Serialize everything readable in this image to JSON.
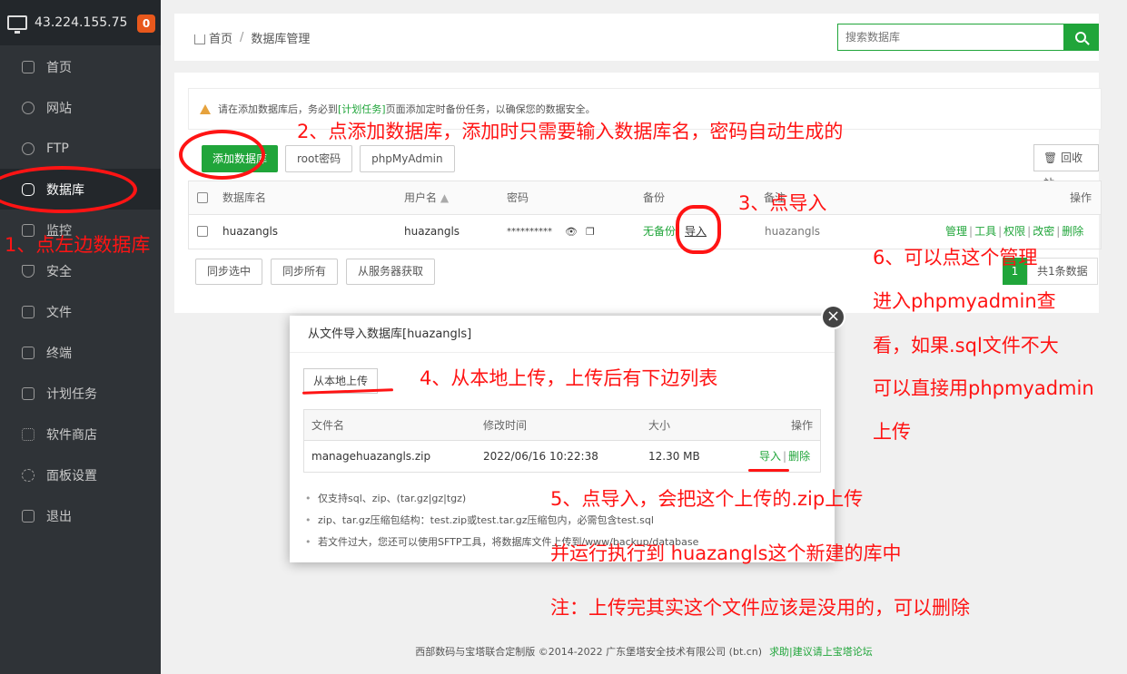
{
  "sidebar": {
    "server_ip": "43.224.155.75",
    "badge": "0",
    "items": [
      {
        "label": "首页",
        "icon": "home-icon"
      },
      {
        "label": "网站",
        "icon": "globe-icon"
      },
      {
        "label": "FTP",
        "icon": "ftp-icon"
      },
      {
        "label": "数据库",
        "icon": "database-icon"
      },
      {
        "label": "监控",
        "icon": "monitor-icon"
      },
      {
        "label": "安全",
        "icon": "shield-icon"
      },
      {
        "label": "文件",
        "icon": "folder-icon"
      },
      {
        "label": "终端",
        "icon": "terminal-icon"
      },
      {
        "label": "计划任务",
        "icon": "calendar-icon"
      },
      {
        "label": "软件商店",
        "icon": "apps-icon"
      },
      {
        "label": "面板设置",
        "icon": "gear-icon"
      },
      {
        "label": "退出",
        "icon": "logout-icon"
      }
    ]
  },
  "header": {
    "crumb_home": "首页",
    "crumb_sep": "/",
    "crumb_current": "数据库管理",
    "search_placeholder": "搜索数据库"
  },
  "notice": {
    "before": "请在添加数据库后，务必到",
    "link": "[计划任务]",
    "after": "页面添加定时备份任务，以确保您的数据安全。"
  },
  "toolbar": {
    "add": "添加数据库",
    "root": "root密码",
    "pma": "phpMyAdmin",
    "recycle": "回收站"
  },
  "db_table": {
    "headers": [
      "数据库名",
      "用户名",
      "密码",
      "备份",
      "备注",
      "操作"
    ],
    "row": {
      "name": "huazangls",
      "user": "huazangls",
      "password": "**********",
      "backup_none": "无备份",
      "backup_import": "导入",
      "remark": "huazangls",
      "actions": [
        "管理",
        "工具",
        "权限",
        "改密",
        "删除"
      ]
    }
  },
  "bottom": {
    "sync_sel": "同步选中",
    "sync_all": "同步所有",
    "fetch": "从服务器获取",
    "page": "1",
    "total": "共1条数据"
  },
  "modal": {
    "title": "从文件导入数据库[huazangls]",
    "upload": "从本地上传",
    "headers": [
      "文件名",
      "修改时间",
      "大小",
      "操作"
    ],
    "file": {
      "name": "managehuazangls.zip",
      "mtime": "2022/06/16 10:22:38",
      "size": "12.30 MB",
      "import": "导入",
      "delete": "删除"
    },
    "tips": [
      "仅支持sql、zip、(tar.gz|gz|tgz)",
      "zip、tar.gz压缩包结构：test.zip或test.tar.gz压缩包内，必需包含test.sql",
      "若文件过大，您还可以使用SFTP工具，将数据库文件上传到/www/backup/database"
    ]
  },
  "footer": {
    "copyright": "西部数码与宝塔联合定制版 ©2014-2022 广东堡塔安全技术有限公司 (bt.cn)",
    "help": "求助|建议请上宝塔论坛"
  },
  "annotations": {
    "a1": "1、点左边数据库",
    "a2": "2、点添加数据库，添加时只需要输入数据库名，密码自动生成的",
    "a3": "3、点导入",
    "a4": "4、从本地上传，上传后有下边列表",
    "a5": "5、点导入，会把这个上传的.zip上传",
    "a5b": "并运行执行到 huazangls这个新建的库中",
    "a6": [
      "6、可以点这个管理",
      "进入phpmyadmin查",
      "看，如果.sql文件不大",
      "可以直接用phpmyadmin",
      "上传"
    ],
    "note": "注：上传完其实这个文件应该是没用的，可以删除"
  }
}
